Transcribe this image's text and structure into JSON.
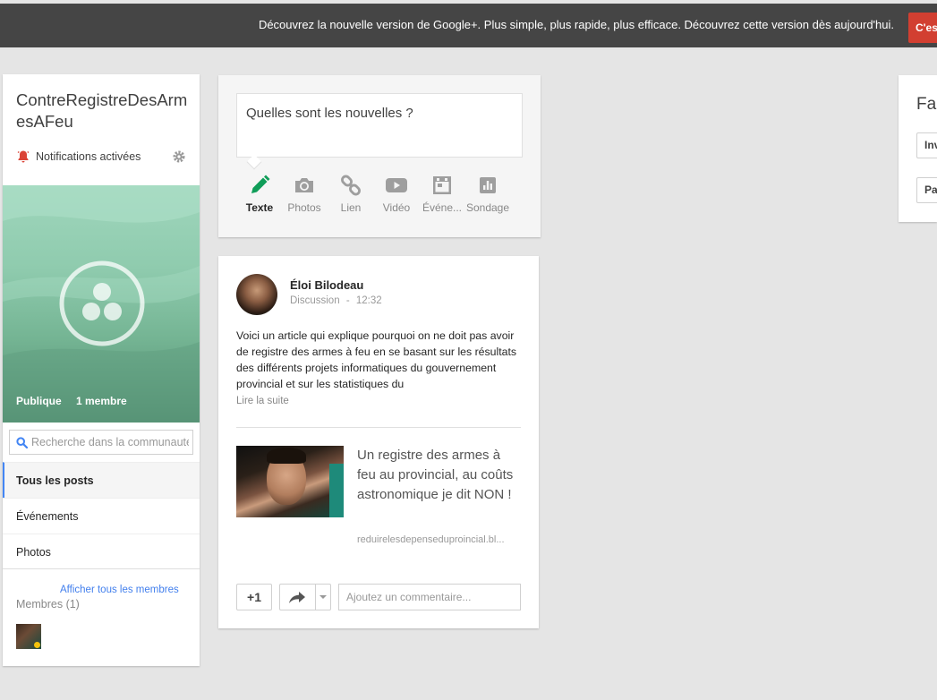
{
  "banner": {
    "message": "Découvrez la nouvelle version de Google+.   Plus simple, plus rapide, plus efficace. Découvrez cette version dès aujourd'hui.",
    "button_label": "C'est parti"
  },
  "community": {
    "name": "ContreRegistreDesArmesAFeu",
    "notifications_label": "Notifications activées",
    "visibility": "Publique",
    "members_count_label": "1 membre",
    "search_placeholder": "Recherche dans la communauté",
    "nav": [
      {
        "label": "Tous les posts",
        "active": true
      },
      {
        "label": "Événements",
        "active": false
      },
      {
        "label": "Photos",
        "active": false
      }
    ],
    "show_all_members_label": "Afficher tous les membres",
    "members_title": "Membres (1)"
  },
  "compose": {
    "placeholder": "Quelles sont les nouvelles ?",
    "actions": [
      {
        "label": "Texte",
        "icon": "pencil-icon",
        "active": true
      },
      {
        "label": "Photos",
        "icon": "camera-icon",
        "active": false
      },
      {
        "label": "Lien",
        "icon": "link-icon",
        "active": false
      },
      {
        "label": "Vidéo",
        "icon": "video-icon",
        "active": false
      },
      {
        "label": "Événe...",
        "icon": "event-icon",
        "active": false
      },
      {
        "label": "Sondage",
        "icon": "poll-icon",
        "active": false
      }
    ]
  },
  "post": {
    "author": "Éloi Bilodeau",
    "category": "Discussion",
    "separator": "-",
    "time": "12:32",
    "text": "Voici un article qui explique pourquoi on ne doit pas avoir de registre des armes à feu en se basant sur les résultats des différents projets informatiques du gouvernement provincial et sur les statistiques du",
    "read_more": "Lire la suite",
    "link_title": "Un registre des armes à feu au provincial, au coûts astronomique je dit NON !",
    "link_url": "reduirelesdepenseduproincial.bl...",
    "plusone_label": "+1",
    "comment_placeholder": "Ajoutez un commentaire..."
  },
  "right_panel": {
    "title": "Fa",
    "buttons": [
      "Inv",
      "Pa"
    ]
  },
  "colors": {
    "banner_bg": "#454545",
    "banner_button": "#d23f31",
    "accent_blue": "#427fed",
    "bell_red": "#db4437",
    "pencil_green": "#0f9d58",
    "cover_green": "#74b493"
  }
}
